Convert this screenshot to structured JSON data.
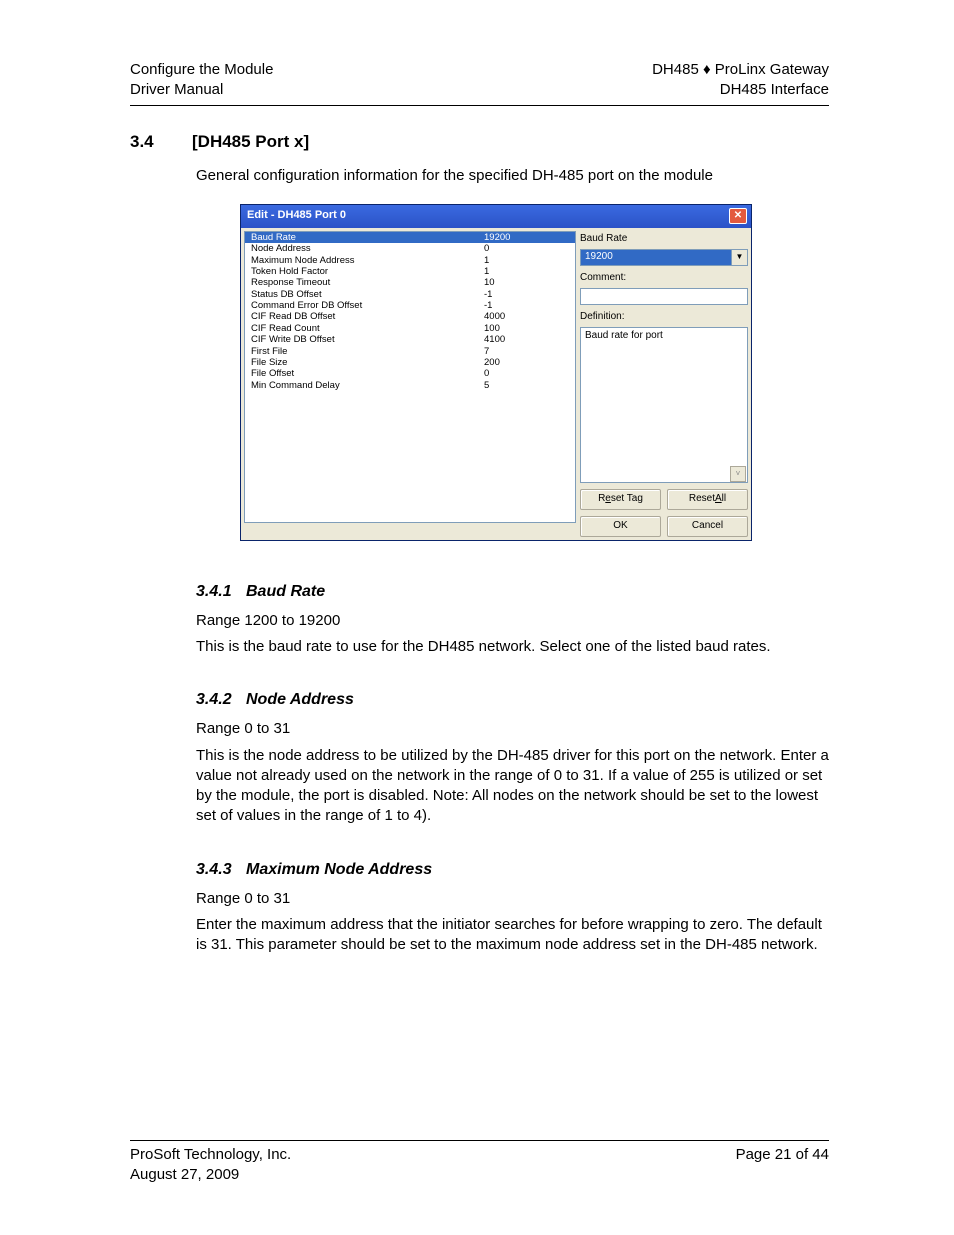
{
  "header": {
    "left1": "Configure the Module",
    "left2": "Driver Manual",
    "right1": "DH485 ♦ ProLinx Gateway",
    "right2": "DH485 Interface"
  },
  "sections": {
    "s34": {
      "num": "3.4",
      "title": "[DH485 Port x]",
      "intro": "General configuration information for the specified DH-485 port on the module"
    },
    "s341": {
      "num": "3.4.1",
      "title": "Baud Rate",
      "range": "Range 1200 to 19200",
      "body": "This is the baud rate to use for the DH485 network. Select one of the listed baud rates."
    },
    "s342": {
      "num": "3.4.2",
      "title": "Node Address",
      "range": "Range 0 to 31",
      "body": "This is the node address to be utilized by the DH-485 driver for this port on the network. Enter a value not already used on the network in the range of 0 to 31. If a value of 255 is utilized or set by the module, the port is disabled. Note: All nodes on the network should be set to the lowest set of values in the range of 1 to 4)."
    },
    "s343": {
      "num": "3.4.3",
      "title": "Maximum Node Address",
      "range": "Range 0 to 31",
      "body": "Enter the maximum address that the initiator searches for before wrapping to zero. The default is 31. This parameter should be set to the maximum node address set in the DH-485 network."
    }
  },
  "dialog": {
    "title": "Edit - DH485 Port 0",
    "params": [
      {
        "label": "Baud Rate",
        "value": "19200",
        "selected": true
      },
      {
        "label": "Node Address",
        "value": "0"
      },
      {
        "label": "Maximum Node Address",
        "value": "1"
      },
      {
        "label": "Token Hold Factor",
        "value": "1"
      },
      {
        "label": "Response Timeout",
        "value": "10"
      },
      {
        "label": "Status DB Offset",
        "value": "-1"
      },
      {
        "label": "Command Error DB Offset",
        "value": "-1"
      },
      {
        "label": "CIF Read DB Offset",
        "value": "4000"
      },
      {
        "label": "CIF Read Count",
        "value": "100"
      },
      {
        "label": "CIF Write DB Offset",
        "value": "4100"
      },
      {
        "label": "First File",
        "value": "7"
      },
      {
        "label": "File Size",
        "value": "200"
      },
      {
        "label": "File Offset",
        "value": "0"
      },
      {
        "label": "Min Command Delay",
        "value": "5"
      }
    ],
    "right": {
      "field_label": "Baud Rate",
      "field_value": "19200",
      "comment_label": "Comment:",
      "definition_label": "Definition:",
      "definition_text": "Baud rate for port"
    },
    "buttons": {
      "reset_tag_pre": "R",
      "reset_tag_u": "e",
      "reset_tag_post": "set Tag",
      "reset_all_pre": "Reset ",
      "reset_all_u": "A",
      "reset_all_post": "ll",
      "ok": "OK",
      "cancel": "Cancel"
    }
  },
  "footer": {
    "left1": "ProSoft Technology, Inc.",
    "left2": "August 27, 2009",
    "right1": "Page 21 of 44"
  }
}
